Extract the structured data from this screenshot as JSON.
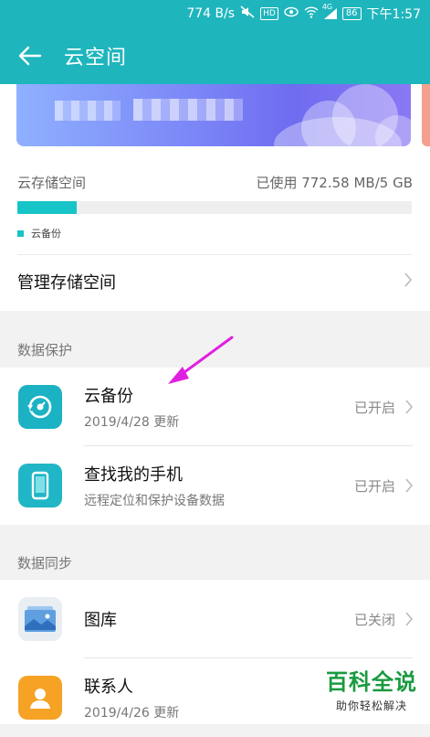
{
  "status_bar": {
    "speed": "774 B/s",
    "hd": "HD",
    "network": "4G",
    "battery": "86",
    "time": "下午1:57"
  },
  "app_bar": {
    "title": "云空间"
  },
  "storage": {
    "label": "云存储空间",
    "usage": "已使用 772.58 MB/5 GB",
    "used_fraction": 0.15,
    "legend": "云备份",
    "manage": "管理存储空间"
  },
  "data_protection": {
    "title": "数据保护",
    "items": [
      {
        "name": "云备份",
        "sub": "2019/4/28 更新",
        "status": "已开启",
        "icon": "cloud-backup-icon"
      },
      {
        "name": "查找我的手机",
        "sub": "远程定位和保护设备数据",
        "status": "已开启",
        "icon": "phone-icon"
      }
    ]
  },
  "data_sync": {
    "title": "数据同步",
    "items": [
      {
        "name": "图库",
        "sub": "",
        "status": "已关闭",
        "icon": "gallery-icon"
      },
      {
        "name": "联系人",
        "sub": "2019/4/26 更新",
        "status": "",
        "icon": "contacts-icon"
      }
    ]
  },
  "watermark": {
    "main": "百科全说",
    "sub": "助你轻松解决"
  },
  "colors": {
    "accent": "#1fb5bd",
    "storage_fill": "#17c4c8",
    "arrow": "#e020e0"
  }
}
